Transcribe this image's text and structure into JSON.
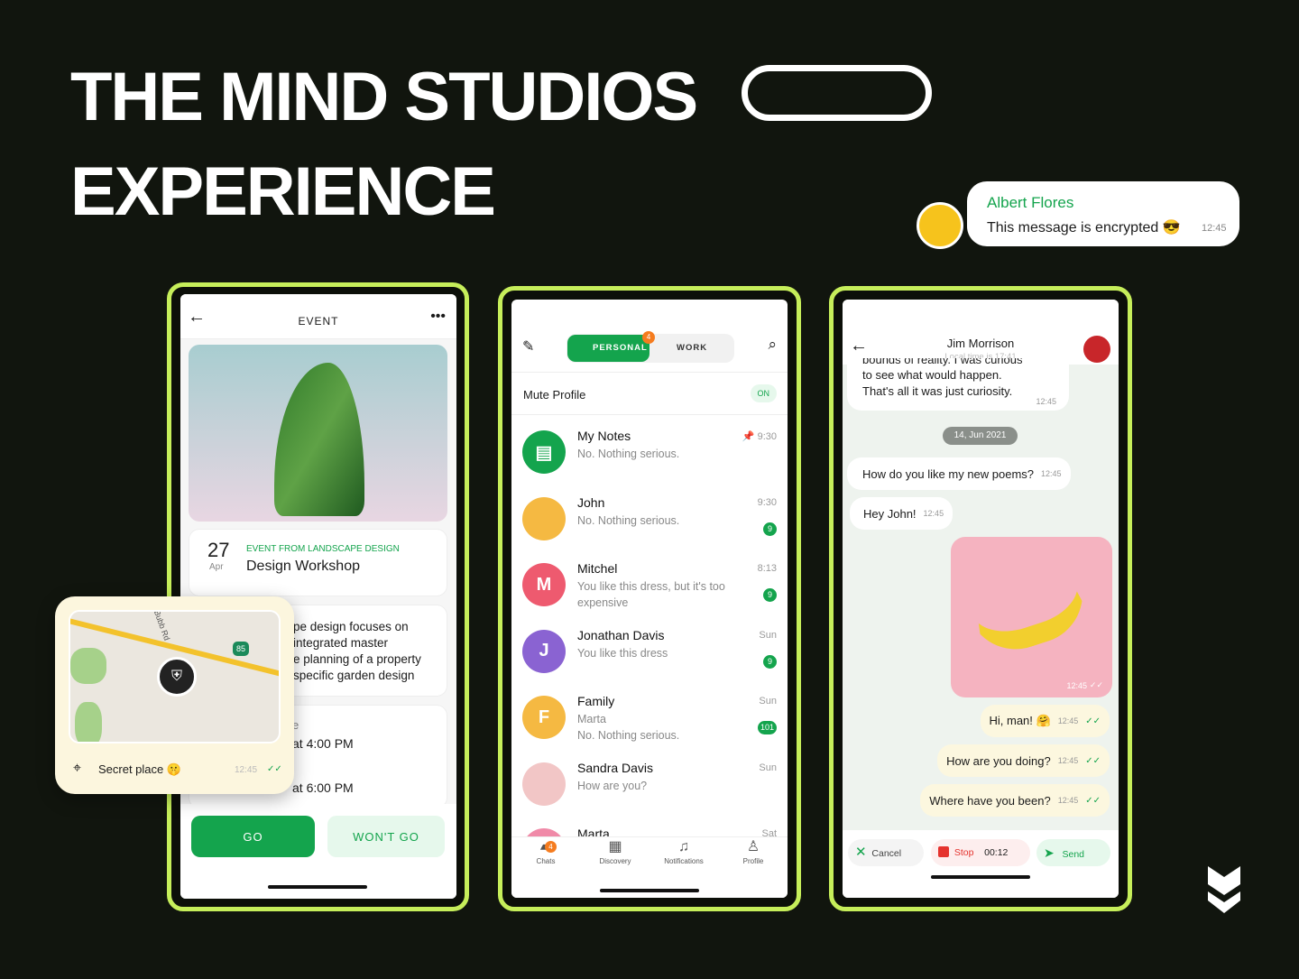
{
  "headline": {
    "line1": "THE MIND STUDIOS",
    "line2": "EXPERIENCE"
  },
  "floating_message": {
    "sender": "Albert Flores",
    "text": "This message is encrypted 😎",
    "time": "12:45"
  },
  "event_screen": {
    "title": "EVENT",
    "date_day": "27",
    "date_month": "Apr",
    "event_label": "EVENT FROM LANDSCAPE DESIGN",
    "event_name": "Design Workshop",
    "description": [
      "pe design focuses on",
      "integrated master",
      "e planning of a property",
      "specific garden design"
    ],
    "time_label": "e",
    "time1": "at 4:00 PM",
    "time2": "at 6:00 PM",
    "go": "GO",
    "wont_go": "WON'T GO"
  },
  "location_card": {
    "label": "Secret place 🤫",
    "time": "12:45",
    "road_number": "85",
    "street": "Bubb Rd"
  },
  "chats_screen": {
    "tabs": [
      {
        "label": "PERSONAL",
        "badge": "4"
      },
      {
        "label": "WORK"
      }
    ],
    "mute_label": "Mute Profile",
    "mute_state": "ON",
    "chats": [
      {
        "name": "My Notes",
        "preview": "No. Nothing serious.",
        "time": "9:30",
        "pinned": true,
        "initial": "",
        "color": "#14a44d"
      },
      {
        "name": "John",
        "preview": "No. Nothing serious.",
        "time": "9:30",
        "badge": "9",
        "initial": "",
        "color": "#f5b942"
      },
      {
        "name": "Mitchel",
        "preview": "You like this dress, but it's too expensive",
        "time": "8:13",
        "badge": "9",
        "initial": "M",
        "color": "#ee5a6f"
      },
      {
        "name": "Jonathan Davis",
        "preview": "You like this dress",
        "time": "Sun",
        "badge": "9",
        "initial": "J",
        "color": "#8a63d2"
      },
      {
        "name": "Family",
        "preview": "Marta\nNo. Nothing serious.",
        "time": "Sun",
        "badge": "101",
        "initial": "F",
        "color": "#f5b942"
      },
      {
        "name": "Sandra Davis",
        "preview": "How are you?",
        "time": "Sun",
        "initial": "",
        "color": "#f2c6c6"
      },
      {
        "name": "Marta",
        "preview": "",
        "time": "Sat",
        "initial": "",
        "color": "#f08aa8"
      }
    ],
    "nav": [
      {
        "label": "Chats",
        "badge": "4"
      },
      {
        "label": "Discovery"
      },
      {
        "label": "Notifications"
      },
      {
        "label": "Profile"
      }
    ]
  },
  "conversation_screen": {
    "contact": "Jim Morrison",
    "subtitle": "Local time is 17:41",
    "first_msg": [
      "bounds of reality. I was curious",
      "to see what would happen.",
      "That's all it was just curiosity."
    ],
    "first_time": "12:45",
    "date_chip": "14, Jun 2021",
    "incoming": [
      {
        "text": "How do you like my new poems?",
        "time": "12:45"
      },
      {
        "text": "Hey John!",
        "time": "12:45"
      }
    ],
    "image_time": "12:45",
    "outgoing": [
      {
        "text": "Hi, man! 🤗",
        "time": "12:45"
      },
      {
        "text": "How are you doing?",
        "time": "12:45"
      },
      {
        "text": "Where have you been?",
        "time": "12:45"
      }
    ],
    "recorder": {
      "cancel": "Cancel",
      "stop": "Stop",
      "duration": "00:12",
      "send": "Send"
    }
  },
  "colors": {
    "accent": "#14a44d",
    "frame": "#c6ee5a",
    "background": "#11150e"
  }
}
